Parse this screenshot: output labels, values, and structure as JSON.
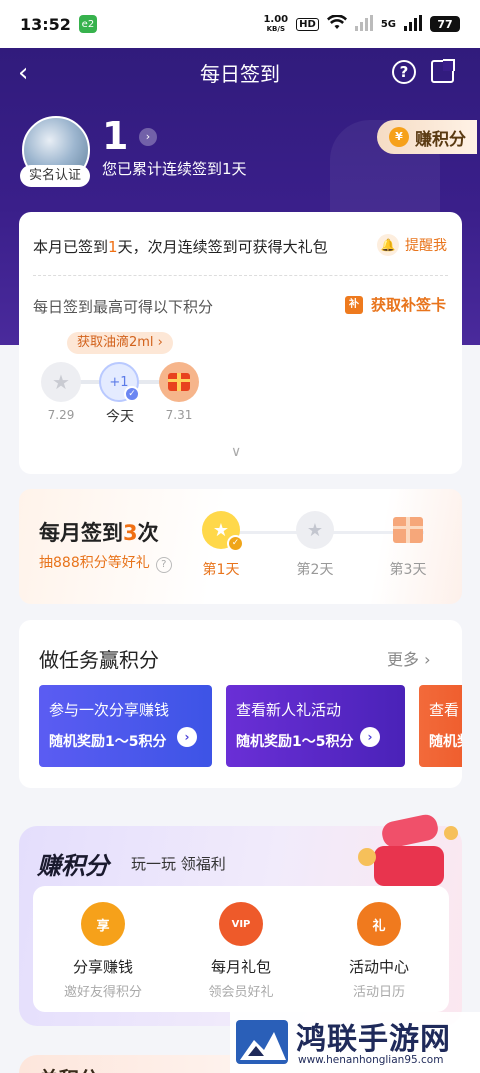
{
  "status_bar": {
    "time": "13:52",
    "app_badge": "e2",
    "net_speed": "1.00",
    "net_unit": "KB/S",
    "hd": "HD",
    "signal": "5G",
    "battery": "77"
  },
  "nav": {
    "title": "每日签到",
    "help": "?"
  },
  "profile": {
    "badge": "实名认证",
    "days": "1",
    "days_text": "您已累计连续签到1天"
  },
  "earn_button": {
    "label": "赚积分",
    "coin": "¥"
  },
  "signin_card": {
    "month_prefix": "本月已签到",
    "month_count": "1",
    "month_suffix": "天，次月连续签到可获得大礼包",
    "remind_label": "提醒我",
    "daily_text": "每日签到最高可得以下积分",
    "makeup_label": "获取补签卡",
    "oil_tip": "获取油滴2ml",
    "days": [
      {
        "date": "7.29",
        "state": "past"
      },
      {
        "date": "今天",
        "state": "today",
        "points": "+1"
      },
      {
        "date": "7.31",
        "state": "gift"
      }
    ]
  },
  "monthly_card": {
    "title_prefix": "每月签到",
    "title_count": "3",
    "title_suffix": "次",
    "subtitle": "抽888积分等好礼",
    "steps": [
      {
        "label": "第1天",
        "state": "done"
      },
      {
        "label": "第2天",
        "state": "pending"
      },
      {
        "label": "第3天",
        "state": "gift"
      }
    ]
  },
  "tasks_card": {
    "title": "做任务赢积分",
    "more": "更多",
    "tasks": [
      {
        "title": "参与一次分享赚钱",
        "reward": "随机奖励1～5积分"
      },
      {
        "title": "查看新人礼活动",
        "reward": "随机奖励1～5积分"
      },
      {
        "title": "查看",
        "reward": "随机奖"
      }
    ]
  },
  "earn_card": {
    "title": "赚积分",
    "subtitle": "玩一玩 领福利",
    "items": [
      {
        "label": "分享赚钱",
        "desc": "邀好友得积分",
        "icon_text": "享",
        "color": "#f6a11a"
      },
      {
        "label": "每月礼包",
        "desc": "领会员好礼",
        "icon_text": "VIP",
        "color": "#ee5a2a"
      },
      {
        "label": "活动中心",
        "desc": "活动日历",
        "icon_text": "礼",
        "color": "#f07a1e"
      }
    ]
  },
  "next_card": {
    "title": "兑积分"
  },
  "watermark": {
    "name": "鸿联手游网",
    "url": "www.henanhonglian95.com"
  },
  "colors": {
    "primary": "#3a1f8a",
    "accent": "#f07014",
    "task_blue": "#4a5ae8",
    "task_purple": "#5a28c6"
  }
}
